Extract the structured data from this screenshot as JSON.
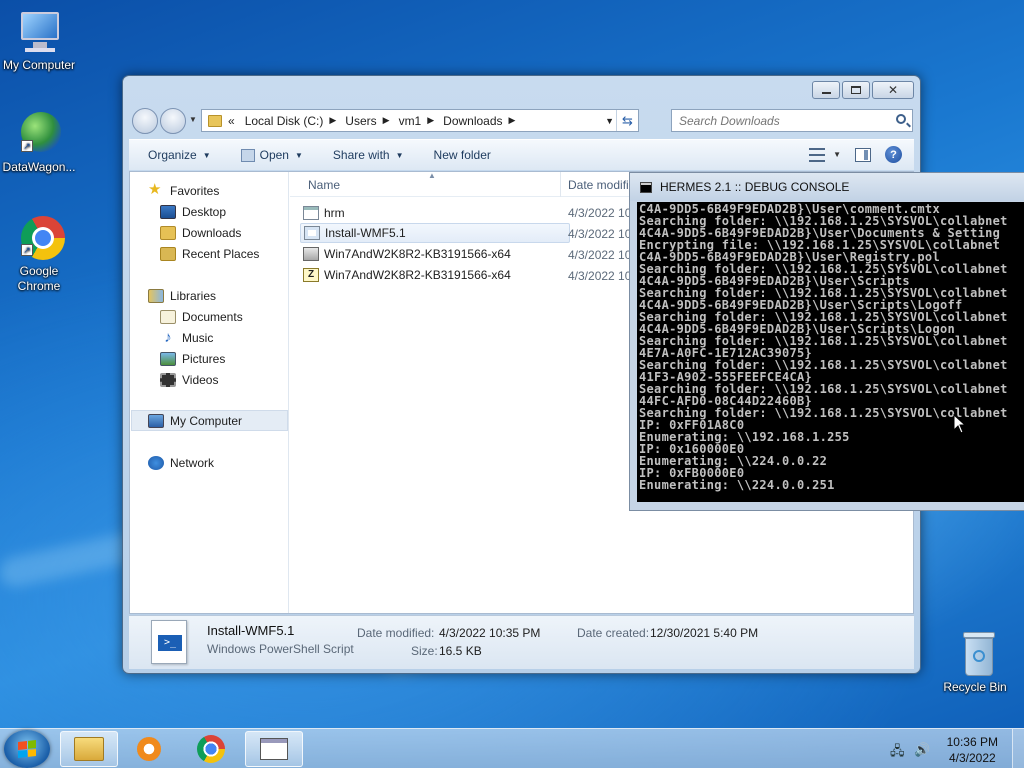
{
  "desktop": {
    "icons": [
      {
        "label": "My Computer"
      },
      {
        "label": "DataWagon..."
      },
      {
        "label": "Google Chrome"
      },
      {
        "label": "Recycle Bin"
      }
    ]
  },
  "explorer": {
    "address": {
      "overflow": "«",
      "crumbs": [
        "Local Disk (C:)",
        "Users",
        "vm1",
        "Downloads"
      ]
    },
    "search": {
      "placeholder": "Search Downloads"
    },
    "toolbar": {
      "organize": "Organize",
      "open": "Open",
      "share_with": "Share with",
      "new_folder": "New folder"
    },
    "nav": {
      "favorites": "Favorites",
      "desktop": "Desktop",
      "downloads": "Downloads",
      "recent": "Recent Places",
      "libraries": "Libraries",
      "documents": "Documents",
      "music": "Music",
      "pictures": "Pictures",
      "videos": "Videos",
      "computer": "My Computer",
      "network": "Network"
    },
    "columns": {
      "name": "Name",
      "date": "Date modifi"
    },
    "files": [
      {
        "name": "hrm",
        "date": "4/3/2022 10:"
      },
      {
        "name": "Install-WMF5.1",
        "date": "4/3/2022 10:"
      },
      {
        "name": "Win7AndW2K8R2-KB3191566-x64",
        "date": "4/3/2022 10:"
      },
      {
        "name": "Win7AndW2K8R2-KB3191566-x64",
        "date": "4/3/2022 10:"
      }
    ],
    "details": {
      "name": "Install-WMF5.1",
      "type": "Windows PowerShell Script",
      "modified_label": "Date modified:",
      "modified_value": "4/3/2022 10:35 PM",
      "created_label": "Date created:",
      "created_value": "12/30/2021 5:40 PM",
      "size_label": "Size:",
      "size_value": "16.5 KB"
    }
  },
  "console": {
    "title": "HERMES 2.1 :: DEBUG CONSOLE",
    "lines": [
      "C4A-9DD5-6B49F9EDAD2B}\\User\\comment.cmtx",
      "Searching folder: \\\\192.168.1.25\\SYSVOL\\collabnet",
      "4C4A-9DD5-6B49F9EDAD2B}\\User\\Documents & Setting",
      "Encrypting file: \\\\192.168.1.25\\SYSVOL\\collabnet",
      "C4A-9DD5-6B49F9EDAD2B}\\User\\Registry.pol",
      "Searching folder: \\\\192.168.1.25\\SYSVOL\\collabnet",
      "4C4A-9DD5-6B49F9EDAD2B}\\User\\Scripts",
      "Searching folder: \\\\192.168.1.25\\SYSVOL\\collabnet",
      "4C4A-9DD5-6B49F9EDAD2B}\\User\\Scripts\\Logoff",
      "Searching folder: \\\\192.168.1.25\\SYSVOL\\collabnet",
      "4C4A-9DD5-6B49F9EDAD2B}\\User\\Scripts\\Logon",
      "Searching folder: \\\\192.168.1.25\\SYSVOL\\collabnet",
      "4E7A-A0FC-1E712AC39075}",
      "Searching folder: \\\\192.168.1.25\\SYSVOL\\collabnet",
      "41F3-A902-555FEEFCE4CA}",
      "Searching folder: \\\\192.168.1.25\\SYSVOL\\collabnet",
      "44FC-AFD0-08C44D22460B}",
      "Searching folder: \\\\192.168.1.25\\SYSVOL\\collabnet",
      "IP: 0xFF01A8C0",
      "Enumerating: \\\\192.168.1.255",
      "IP: 0x160000E0",
      "Enumerating: \\\\224.0.0.22",
      "IP: 0xFB0000E0",
      "Enumerating: \\\\224.0.0.251"
    ]
  },
  "taskbar": {
    "clock_time": "10:36 PM",
    "clock_date": "4/3/2022"
  }
}
